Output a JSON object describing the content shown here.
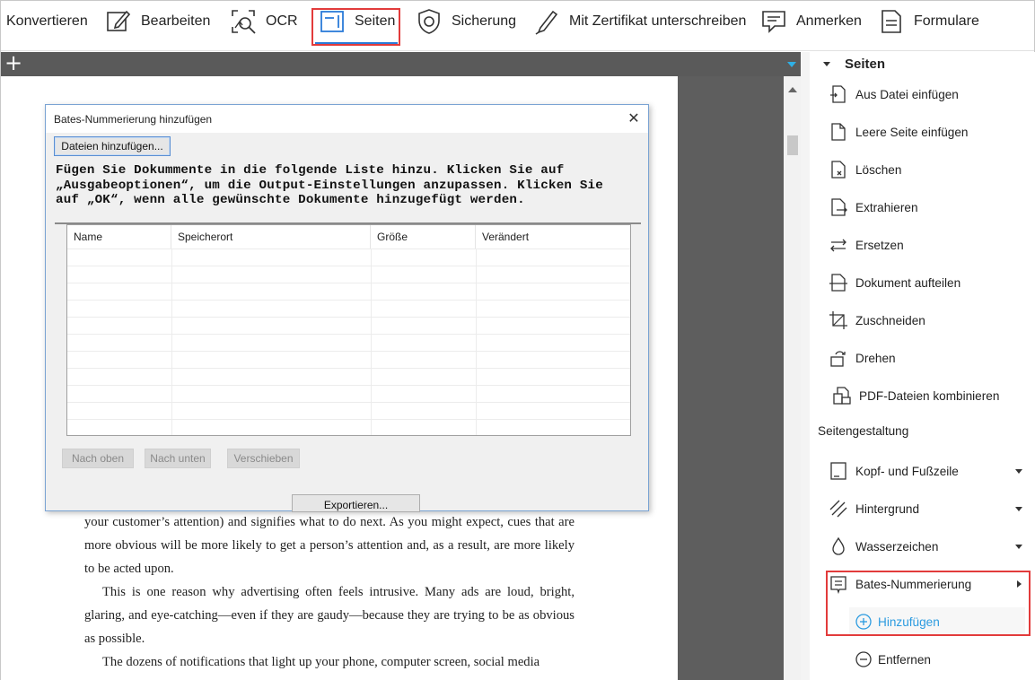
{
  "toolbar": {
    "items": [
      {
        "label": "Konvertieren",
        "icon": "convert-icon"
      },
      {
        "label": "Bearbeiten",
        "icon": "edit-pencil-icon"
      },
      {
        "label": "OCR",
        "icon": "ocr-scan-icon"
      },
      {
        "label": "Seiten",
        "icon": "pages-icon",
        "active": true
      },
      {
        "label": "Sicherung",
        "icon": "shield-icon"
      },
      {
        "label": "Mit Zertifikat unterschreiben",
        "icon": "pen-sign-icon"
      },
      {
        "label": "Anmerken",
        "icon": "comment-icon"
      },
      {
        "label": "Formulare",
        "icon": "form-icon"
      }
    ],
    "accent_color": "#2b7bd8",
    "highlight_color": "#e23b3b"
  },
  "document": {
    "tab_add_label": "+",
    "paragraphs": [
      {
        "text": "your customer’s attention) and signifies what to do next. As you might expect, cues that are more obvious will be more likely to get a person’s attention and, as a result, are more likely to be acted upon.",
        "indent": false
      },
      {
        "text": "This is one reason why advertising often feels intrusive. Many ads are loud, bright, glaring, and eye-catching—even if they are gaudy—because they are trying to be as obvious as possible.",
        "indent": true
      },
      {
        "text": "The dozens of notifications that light up your phone, computer screen, social media",
        "indent": true
      }
    ]
  },
  "dialog": {
    "title": "Bates-Nummerierung hinzufügen",
    "close_symbol": "✕",
    "add_files_button": "Dateien hinzufügen...",
    "instruction": "Fügen Sie Dokummente in die folgende Liste hinzu. Klicken Sie auf „Ausgabeoptionen“, um die Output-Einstellungen anzupassen. Klicken Sie auf „OK“, wenn alle gewünschte Dokumente hinzugefügt werden.",
    "columns": [
      "Name",
      "Speicherort",
      "Größe",
      "Verändert"
    ],
    "rows": [],
    "buttons": {
      "move_up": "Nach oben",
      "move_down": "Nach unten",
      "move": "Verschieben",
      "export": "Exportieren..."
    }
  },
  "panel": {
    "header": "Seiten",
    "items": [
      {
        "label": "Aus Datei einfügen",
        "icon": "insert-from-file-icon"
      },
      {
        "label": "Leere Seite einfügen",
        "icon": "blank-page-icon"
      },
      {
        "label": "Löschen",
        "icon": "delete-page-icon"
      },
      {
        "label": "Extrahieren",
        "icon": "extract-page-icon"
      },
      {
        "label": "Ersetzen",
        "icon": "replace-arrows-icon"
      },
      {
        "label": "Dokument aufteilen",
        "icon": "split-document-icon"
      },
      {
        "label": "Zuschneiden",
        "icon": "crop-icon"
      },
      {
        "label": "Drehen",
        "icon": "rotate-icon"
      },
      {
        "label": "PDF-Dateien kombinieren",
        "icon": "combine-files-icon"
      }
    ],
    "section_title": "Seitengestaltung",
    "design_items": [
      {
        "label": "Kopf- und Fußzeile",
        "icon": "header-footer-icon",
        "arrow": "down"
      },
      {
        "label": "Hintergrund",
        "icon": "background-stripes-icon",
        "arrow": "down"
      },
      {
        "label": "Wasserzeichen",
        "icon": "watermark-drop-icon",
        "arrow": "down"
      },
      {
        "label": "Bates-Nummerierung",
        "icon": "bates-bookmark-icon",
        "arrow": "right"
      }
    ],
    "sub_items": [
      {
        "label": "Hinzufügen",
        "icon": "plus-circle-icon",
        "color": "#2b9be0"
      },
      {
        "label": "Entfernen",
        "icon": "minus-circle-icon",
        "color": "#222222"
      }
    ]
  }
}
